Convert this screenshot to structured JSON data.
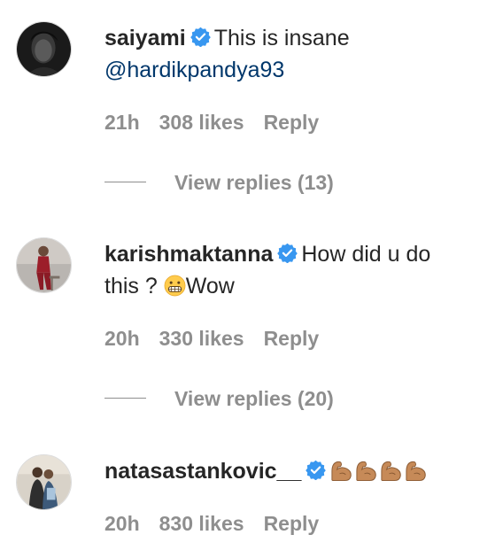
{
  "colors": {
    "text": "#262626",
    "muted": "#8e8e8e",
    "mention": "#00376b",
    "verified_badge": "#3897f0"
  },
  "comments": [
    {
      "username": "saiyami",
      "verified": true,
      "text": "This is insane",
      "mention": "@hardikpandya93",
      "time": "21h",
      "likes": "308 likes",
      "reply": "Reply",
      "view_replies": "View replies (13)"
    },
    {
      "username": "karishmaktanna",
      "verified": true,
      "text": "How did u do",
      "text_line2": "this ?",
      "emoji": "grimacing-face",
      "text_after_emoji": "Wow",
      "time": "20h",
      "likes": "330 likes",
      "reply": "Reply",
      "view_replies": "View replies (20)"
    },
    {
      "username": "natasastankovic__",
      "verified": true,
      "emoji": "flexed-biceps",
      "emoji_count": 4,
      "time": "20h",
      "likes": "830 likes",
      "reply": "Reply"
    }
  ]
}
